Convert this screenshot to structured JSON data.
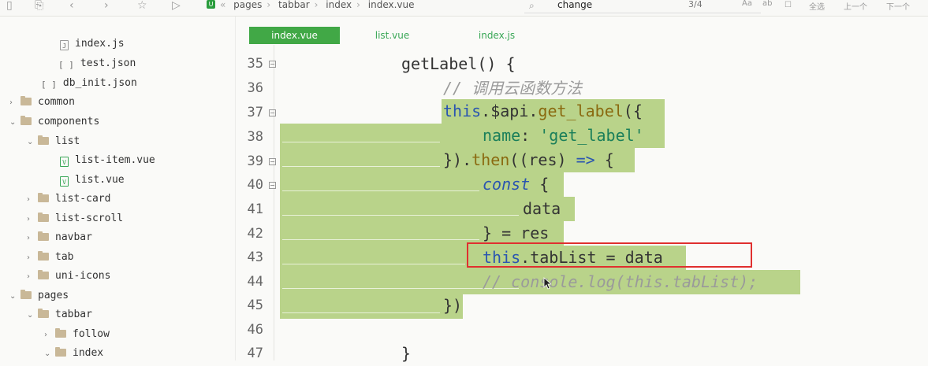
{
  "toolbar": {
    "breadcrumb": [
      "pages",
      "tabbar",
      "index",
      "index.vue"
    ],
    "find": {
      "value": "change",
      "count": "3/4",
      "buttons": [
        "Aa",
        "ab",
        "全选",
        "上一个",
        "下一个"
      ]
    }
  },
  "sidebar": {
    "items": [
      {
        "label": "index.js",
        "type": "file-js",
        "depth": 3
      },
      {
        "label": "test.json",
        "type": "file-json",
        "depth": 3
      },
      {
        "label": "db_init.json",
        "type": "file-json",
        "depth": 2
      },
      {
        "label": "common",
        "type": "folder",
        "depth": 1,
        "expanded": false
      },
      {
        "label": "components",
        "type": "folder",
        "depth": 1,
        "expanded": true
      },
      {
        "label": "list",
        "type": "folder",
        "depth": 2,
        "expanded": true
      },
      {
        "label": "list-item.vue",
        "type": "file-vue",
        "depth": 3
      },
      {
        "label": "list.vue",
        "type": "file-vue",
        "depth": 3
      },
      {
        "label": "list-card",
        "type": "folder",
        "depth": 2,
        "expanded": false
      },
      {
        "label": "list-scroll",
        "type": "folder",
        "depth": 2,
        "expanded": false
      },
      {
        "label": "navbar",
        "type": "folder",
        "depth": 2,
        "expanded": false
      },
      {
        "label": "tab",
        "type": "folder",
        "depth": 2,
        "expanded": false
      },
      {
        "label": "uni-icons",
        "type": "folder",
        "depth": 2,
        "expanded": false
      },
      {
        "label": "pages",
        "type": "folder",
        "depth": 1,
        "expanded": true
      },
      {
        "label": "tabbar",
        "type": "folder",
        "depth": 2,
        "expanded": true
      },
      {
        "label": "follow",
        "type": "folder",
        "depth": 3,
        "expanded": false
      },
      {
        "label": "index",
        "type": "folder",
        "depth": 3,
        "expanded": true
      }
    ]
  },
  "editor": {
    "tabs": [
      {
        "label": "index.vue",
        "active": true
      },
      {
        "label": "list.vue",
        "active": false
      },
      {
        "label": "index.js",
        "active": false
      }
    ],
    "lines": [
      {
        "num": "35",
        "fold": true
      },
      {
        "num": "36",
        "fold": false
      },
      {
        "num": "37",
        "fold": true
      },
      {
        "num": "38",
        "fold": false
      },
      {
        "num": "39",
        "fold": true
      },
      {
        "num": "40",
        "fold": true
      },
      {
        "num": "41",
        "fold": false
      },
      {
        "num": "42",
        "fold": false
      },
      {
        "num": "43",
        "fold": false
      },
      {
        "num": "44",
        "fold": false
      },
      {
        "num": "45",
        "fold": false
      },
      {
        "num": "46",
        "fold": false
      },
      {
        "num": "47",
        "fold": false
      }
    ],
    "code": {
      "l35": "getLabel() {",
      "l36": "// 调用云函数方法",
      "l37_this": "this",
      "l37_api": ".$api.",
      "l37_fn": "get_label",
      "l37_rest": "({",
      "l38_key": "name",
      "l38_colon": ": ",
      "l38_str": "'get_label'",
      "l39_a": "}).",
      "l39_fn": "then",
      "l39_b": "((res) ",
      "l39_arrow": "=>",
      "l39_c": " {",
      "l40_kw": "const",
      "l40_b": " {",
      "l41": "data",
      "l42": "} = res",
      "l43_this": "this",
      "l43_rest": ".tabList = data",
      "l44": "// console.log(this.tabList);",
      "l45": "})",
      "l47": "}"
    },
    "fold_marker": "−"
  },
  "colors": {
    "selection": "#b9d38a",
    "highlight_box": "#e02f2f",
    "active_tab": "#41a846"
  }
}
